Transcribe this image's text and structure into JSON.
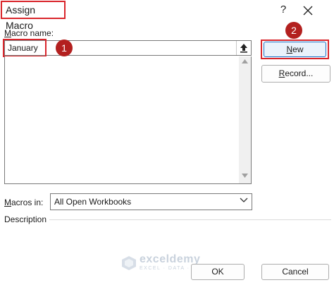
{
  "dialog": {
    "title": "Assign Macro",
    "help_label": "?"
  },
  "macro_name": {
    "label_prefix": "",
    "label_accel": "M",
    "label_rest": "acro name:",
    "value": "January"
  },
  "badges": {
    "step1": "1",
    "step2": "2"
  },
  "buttons": {
    "new_accel": "N",
    "new_rest": "ew",
    "record_accel": "R",
    "record_rest": "ecord...",
    "ok": "OK",
    "cancel": "Cancel"
  },
  "macros_in": {
    "label_accel": "M",
    "label_rest": "acros in:",
    "selected": "All Open Workbooks"
  },
  "description": {
    "label": "Description"
  },
  "watermark": {
    "title": "exceldemy",
    "subtitle": "EXCEL · DATA · BI"
  },
  "icons": {
    "close": "close-icon",
    "upload": "collapse-dialog-icon",
    "dropdown": "chevron-down-icon",
    "scroll_up": "scroll-up-icon",
    "scroll_down": "scroll-down-icon"
  },
  "colors": {
    "highlight": "#d9262c",
    "badge": "#b3201f",
    "focus_border": "#1a73c9"
  }
}
